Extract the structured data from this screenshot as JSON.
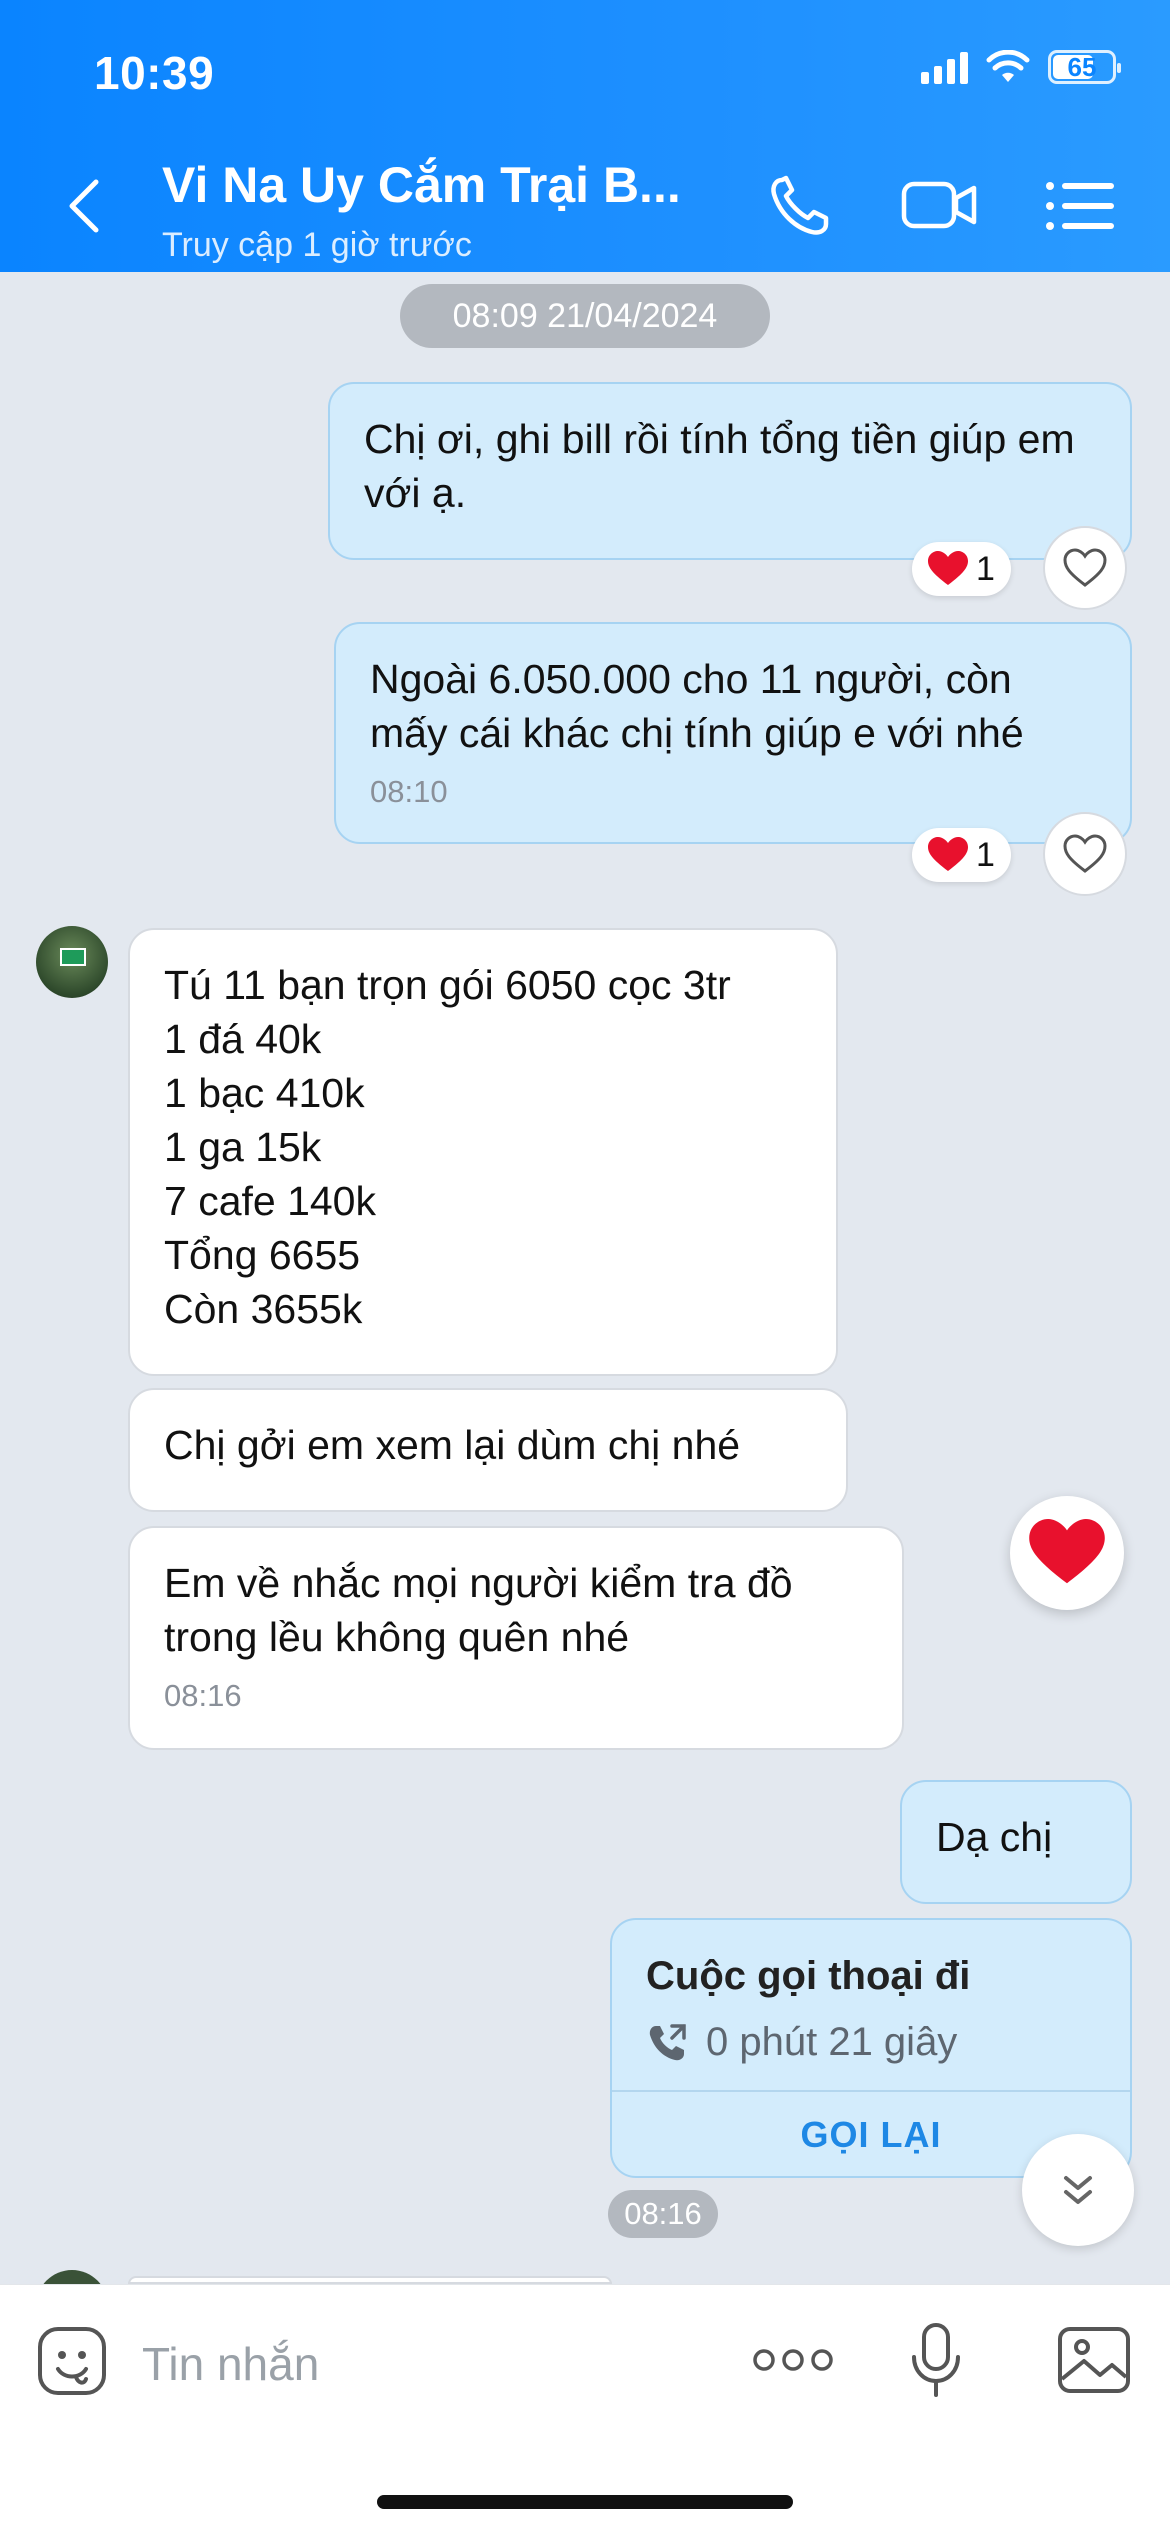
{
  "status_bar": {
    "time": "10:39",
    "battery": "65"
  },
  "header": {
    "title": "Vi Na Uy Cắm Trại B...",
    "subtitle": "Truy cập 1 giờ trước"
  },
  "chat": {
    "date_chip": "08:09 21/04/2024",
    "messages": [
      {
        "text": "Chị ơi, ghi bill rồi tính tổng tiền giúp em với ạ.",
        "reaction_count": "1"
      },
      {
        "text": "Ngoài 6.050.000 cho 11 người, còn mấy cái khác chị tính giúp e với nhé",
        "time": "08:10",
        "reaction_count": "1"
      },
      {
        "lines": [
          "Tú 11 bạn trọn gói 6050 cọc 3tr",
          "1 đá 40k",
          "1 bạc 410k",
          "1 ga 15k",
          "7 cafe 140k",
          "Tổng 6655",
          "Còn 3655k"
        ]
      },
      {
        "text": "Chị gởi em xem lại dùm chị nhé"
      },
      {
        "text": "Em về nhắc mọi người kiểm tra đồ trong lều không quên nhé",
        "time": "08:16"
      },
      {
        "text": "Dạ chị"
      }
    ],
    "call_card": {
      "title": "Cuộc gọi thoại đi",
      "duration": "0 phút 21 giây",
      "action": "GỌI LẠI"
    },
    "last_time": "08:16"
  },
  "input": {
    "placeholder": "Tin nhắn"
  },
  "icons": {
    "reaction": "heart-icon",
    "colors": {
      "header": "#0a84ff",
      "outgoing": "#d3ecfc",
      "incoming": "#ffffff",
      "heart": "#e8112d",
      "link": "#1e88e5"
    }
  }
}
